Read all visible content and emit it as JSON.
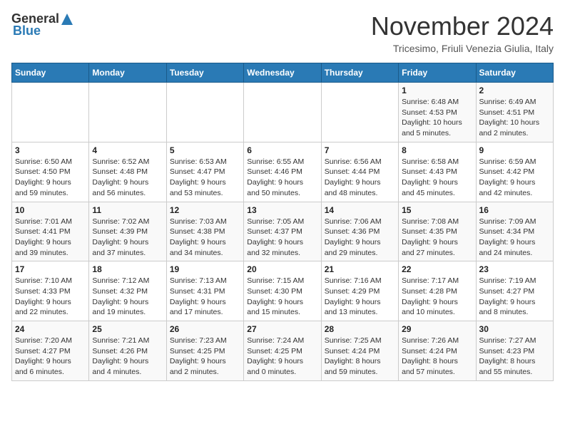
{
  "logo": {
    "general": "General",
    "blue": "Blue"
  },
  "title": "November 2024",
  "location": "Tricesimo, Friuli Venezia Giulia, Italy",
  "days_of_week": [
    "Sunday",
    "Monday",
    "Tuesday",
    "Wednesday",
    "Thursday",
    "Friday",
    "Saturday"
  ],
  "weeks": [
    [
      {
        "day": "",
        "info": ""
      },
      {
        "day": "",
        "info": ""
      },
      {
        "day": "",
        "info": ""
      },
      {
        "day": "",
        "info": ""
      },
      {
        "day": "",
        "info": ""
      },
      {
        "day": "1",
        "info": "Sunrise: 6:48 AM\nSunset: 4:53 PM\nDaylight: 10 hours\nand 5 minutes."
      },
      {
        "day": "2",
        "info": "Sunrise: 6:49 AM\nSunset: 4:51 PM\nDaylight: 10 hours\nand 2 minutes."
      }
    ],
    [
      {
        "day": "3",
        "info": "Sunrise: 6:50 AM\nSunset: 4:50 PM\nDaylight: 9 hours\nand 59 minutes."
      },
      {
        "day": "4",
        "info": "Sunrise: 6:52 AM\nSunset: 4:48 PM\nDaylight: 9 hours\nand 56 minutes."
      },
      {
        "day": "5",
        "info": "Sunrise: 6:53 AM\nSunset: 4:47 PM\nDaylight: 9 hours\nand 53 minutes."
      },
      {
        "day": "6",
        "info": "Sunrise: 6:55 AM\nSunset: 4:46 PM\nDaylight: 9 hours\nand 50 minutes."
      },
      {
        "day": "7",
        "info": "Sunrise: 6:56 AM\nSunset: 4:44 PM\nDaylight: 9 hours\nand 48 minutes."
      },
      {
        "day": "8",
        "info": "Sunrise: 6:58 AM\nSunset: 4:43 PM\nDaylight: 9 hours\nand 45 minutes."
      },
      {
        "day": "9",
        "info": "Sunrise: 6:59 AM\nSunset: 4:42 PM\nDaylight: 9 hours\nand 42 minutes."
      }
    ],
    [
      {
        "day": "10",
        "info": "Sunrise: 7:01 AM\nSunset: 4:41 PM\nDaylight: 9 hours\nand 39 minutes."
      },
      {
        "day": "11",
        "info": "Sunrise: 7:02 AM\nSunset: 4:39 PM\nDaylight: 9 hours\nand 37 minutes."
      },
      {
        "day": "12",
        "info": "Sunrise: 7:03 AM\nSunset: 4:38 PM\nDaylight: 9 hours\nand 34 minutes."
      },
      {
        "day": "13",
        "info": "Sunrise: 7:05 AM\nSunset: 4:37 PM\nDaylight: 9 hours\nand 32 minutes."
      },
      {
        "day": "14",
        "info": "Sunrise: 7:06 AM\nSunset: 4:36 PM\nDaylight: 9 hours\nand 29 minutes."
      },
      {
        "day": "15",
        "info": "Sunrise: 7:08 AM\nSunset: 4:35 PM\nDaylight: 9 hours\nand 27 minutes."
      },
      {
        "day": "16",
        "info": "Sunrise: 7:09 AM\nSunset: 4:34 PM\nDaylight: 9 hours\nand 24 minutes."
      }
    ],
    [
      {
        "day": "17",
        "info": "Sunrise: 7:10 AM\nSunset: 4:33 PM\nDaylight: 9 hours\nand 22 minutes."
      },
      {
        "day": "18",
        "info": "Sunrise: 7:12 AM\nSunset: 4:32 PM\nDaylight: 9 hours\nand 19 minutes."
      },
      {
        "day": "19",
        "info": "Sunrise: 7:13 AM\nSunset: 4:31 PM\nDaylight: 9 hours\nand 17 minutes."
      },
      {
        "day": "20",
        "info": "Sunrise: 7:15 AM\nSunset: 4:30 PM\nDaylight: 9 hours\nand 15 minutes."
      },
      {
        "day": "21",
        "info": "Sunrise: 7:16 AM\nSunset: 4:29 PM\nDaylight: 9 hours\nand 13 minutes."
      },
      {
        "day": "22",
        "info": "Sunrise: 7:17 AM\nSunset: 4:28 PM\nDaylight: 9 hours\nand 10 minutes."
      },
      {
        "day": "23",
        "info": "Sunrise: 7:19 AM\nSunset: 4:27 PM\nDaylight: 9 hours\nand 8 minutes."
      }
    ],
    [
      {
        "day": "24",
        "info": "Sunrise: 7:20 AM\nSunset: 4:27 PM\nDaylight: 9 hours\nand 6 minutes."
      },
      {
        "day": "25",
        "info": "Sunrise: 7:21 AM\nSunset: 4:26 PM\nDaylight: 9 hours\nand 4 minutes."
      },
      {
        "day": "26",
        "info": "Sunrise: 7:23 AM\nSunset: 4:25 PM\nDaylight: 9 hours\nand 2 minutes."
      },
      {
        "day": "27",
        "info": "Sunrise: 7:24 AM\nSunset: 4:25 PM\nDaylight: 9 hours\nand 0 minutes."
      },
      {
        "day": "28",
        "info": "Sunrise: 7:25 AM\nSunset: 4:24 PM\nDaylight: 8 hours\nand 59 minutes."
      },
      {
        "day": "29",
        "info": "Sunrise: 7:26 AM\nSunset: 4:24 PM\nDaylight: 8 hours\nand 57 minutes."
      },
      {
        "day": "30",
        "info": "Sunrise: 7:27 AM\nSunset: 4:23 PM\nDaylight: 8 hours\nand 55 minutes."
      }
    ]
  ]
}
